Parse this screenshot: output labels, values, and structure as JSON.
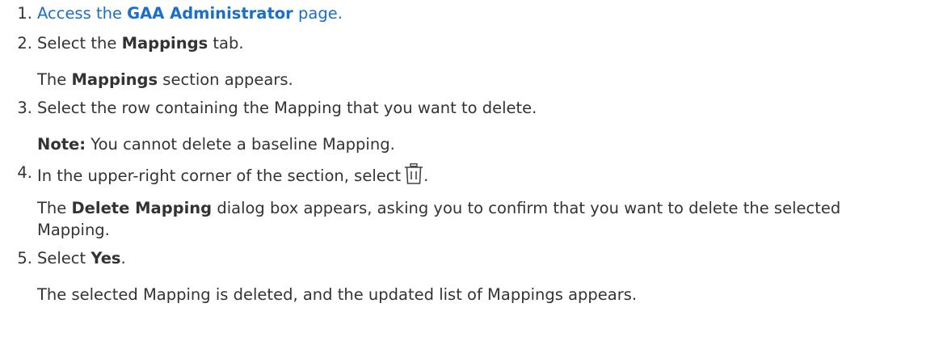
{
  "steps": [
    {
      "number": "1.",
      "before": "Access the ",
      "bold": "GAA Administrator",
      "after": " page."
    },
    {
      "number": "2.",
      "before": "Select the ",
      "bold": "Mappings",
      "after": " tab.",
      "result_bold": "Mappings",
      "result_after": " section appears.",
      "result_before": "The "
    },
    {
      "number": "3.",
      "text": "Select the row containing the Mapping that you want to delete.",
      "note_label": "Note:",
      "note_text": " You cannot delete a baseline Mapping."
    },
    {
      "number": "4.",
      "before": "In the upper-right corner of the section, select",
      "after": ".",
      "icon": "trash-icon",
      "result_before": "The ",
      "result_bold": "Delete Mapping",
      "result_after": " dialog box appears, asking you to confirm that you want to delete the selected",
      "result_line2": "Mapping."
    },
    {
      "number": "5.",
      "before": "Select ",
      "bold": "Yes",
      "after": ".",
      "result": "The selected Mapping is deleted, and the updated list of Mappings appears."
    }
  ],
  "colors": {
    "link": "#1a6fc9",
    "text": "#333333"
  }
}
